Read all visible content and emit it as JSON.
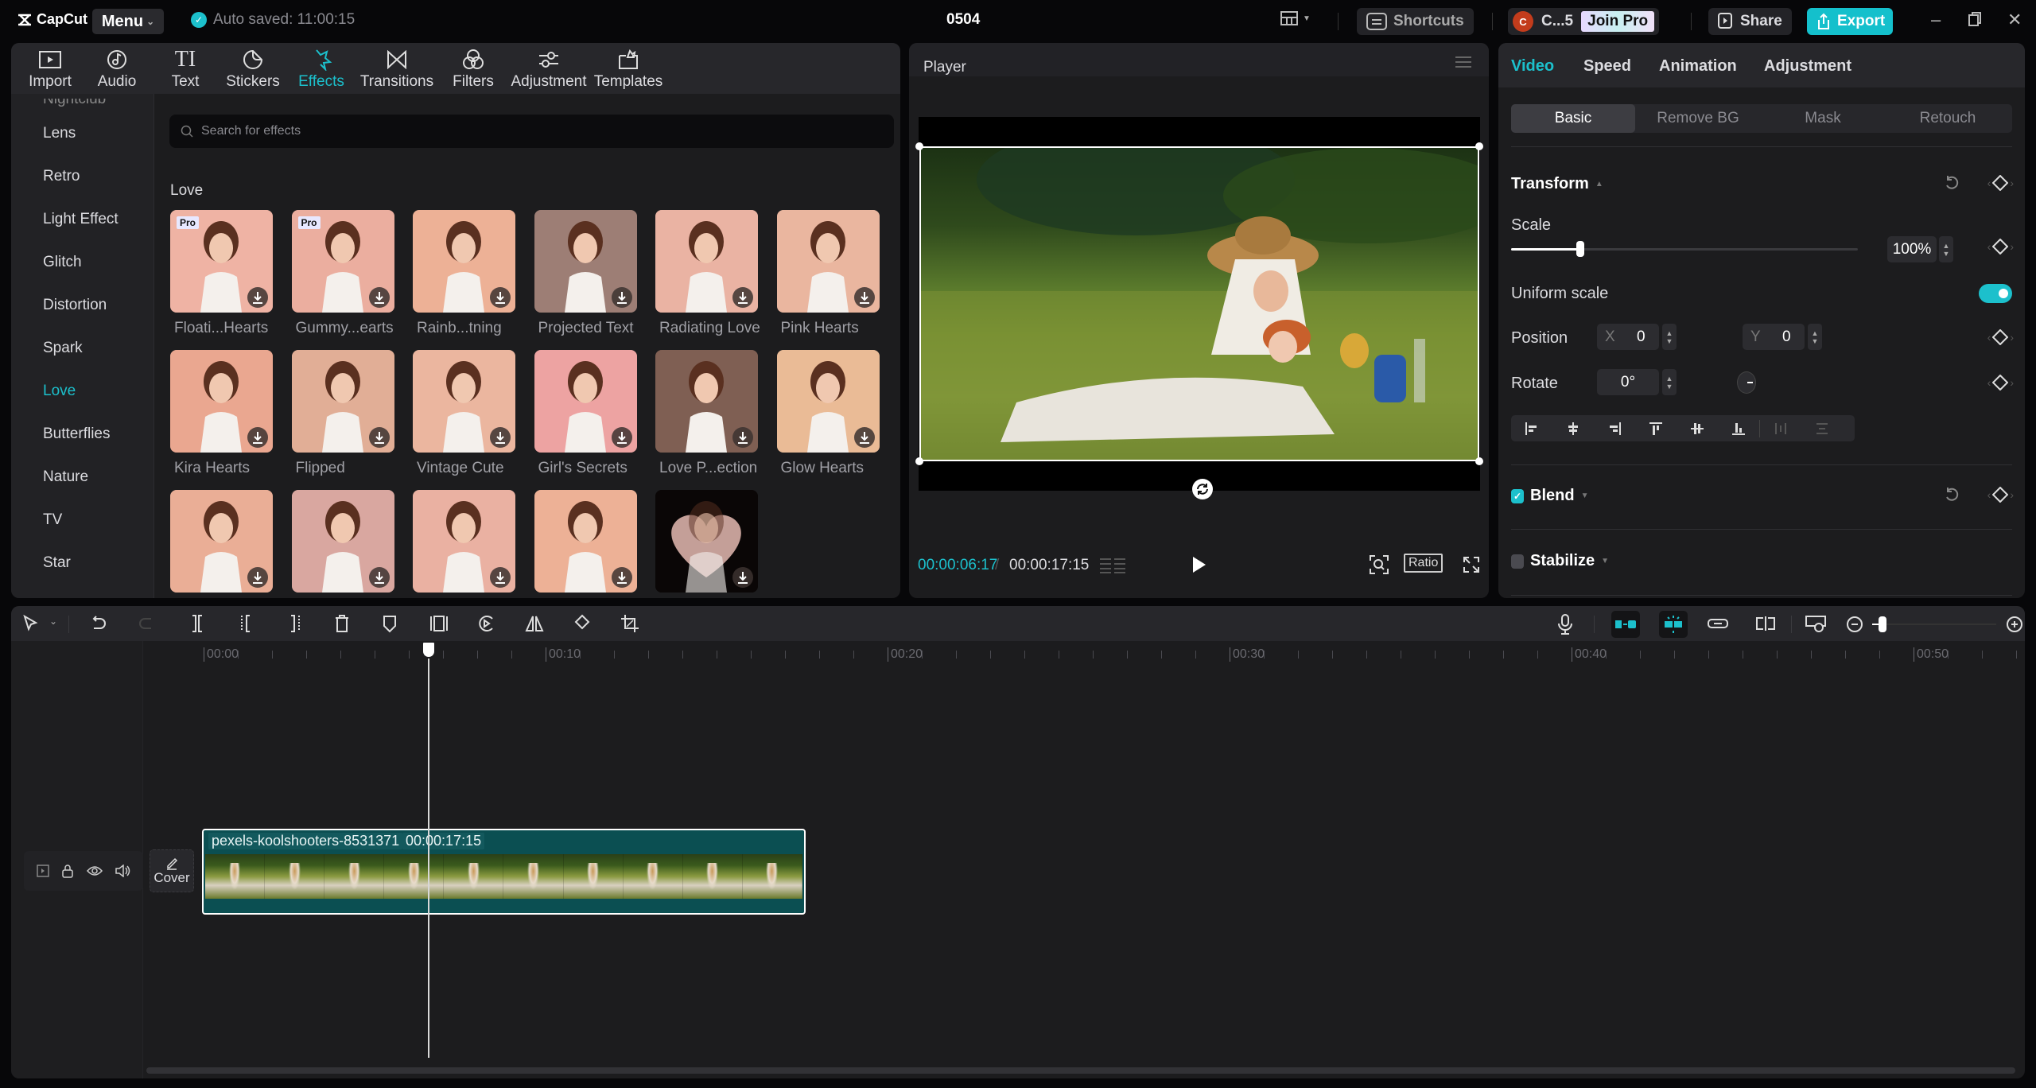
{
  "app": {
    "name": "CapCut",
    "menu_label": "Menu",
    "autosave": "Auto saved: 11:00:15",
    "project_title": "0504",
    "shortcuts_label": "Shortcuts",
    "user_initial": "C",
    "user_name": "C...5",
    "join_pro_label": "Join Pro",
    "share_label": "Share",
    "export_label": "Export",
    "accent_color": "#1cc0cc"
  },
  "toolbar": {
    "items": [
      {
        "label": "Import",
        "icon": "import-icon"
      },
      {
        "label": "Audio",
        "icon": "audio-icon"
      },
      {
        "label": "Text",
        "icon": "text-icon"
      },
      {
        "label": "Stickers",
        "icon": "sticker-icon"
      },
      {
        "label": "Effects",
        "icon": "effects-icon",
        "active": true
      },
      {
        "label": "Transitions",
        "icon": "transitions-icon"
      },
      {
        "label": "Filters",
        "icon": "filters-icon"
      },
      {
        "label": "Adjustment",
        "icon": "adjustment-icon"
      },
      {
        "label": "Templates",
        "icon": "templates-icon"
      }
    ]
  },
  "categories": {
    "partial_top": "Nightclub",
    "items": [
      "Lens",
      "Retro",
      "Light Effect",
      "Glitch",
      "Distortion",
      "Spark",
      "Love",
      "Butterflies",
      "Nature",
      "TV",
      "Star"
    ],
    "active": "Love"
  },
  "effects": {
    "search_placeholder": "Search for effects",
    "section_title": "Love",
    "items": [
      {
        "label": "Floati...Hearts",
        "pro": true
      },
      {
        "label": "Gummy...earts",
        "pro": true
      },
      {
        "label": "Rainb...tning",
        "pro": false
      },
      {
        "label": "Projected Text",
        "pro": false
      },
      {
        "label": "Radiating Love",
        "pro": false
      },
      {
        "label": "Pink Hearts",
        "pro": false
      },
      {
        "label": "Kira Hearts",
        "pro": false
      },
      {
        "label": "Flipped",
        "pro": false
      },
      {
        "label": "Vintage Cute",
        "pro": false
      },
      {
        "label": "Girl's Secrets",
        "pro": false
      },
      {
        "label": "Love P...ection",
        "pro": false
      },
      {
        "label": "Glow Hearts",
        "pro": false
      },
      {
        "label": "",
        "pro": false
      },
      {
        "label": "",
        "pro": false
      },
      {
        "label": "",
        "pro": false
      },
      {
        "label": "",
        "pro": false
      },
      {
        "label": "",
        "pro": false
      }
    ],
    "pro_badge": "Pro"
  },
  "player": {
    "title": "Player",
    "current_time": "00:00:06:17",
    "separator": "/",
    "total_time": "00:00:17:15",
    "ratio_label": "Ratio"
  },
  "inspector": {
    "tabs": [
      "Video",
      "Speed",
      "Animation",
      "Adjustment"
    ],
    "active_tab": "Video",
    "subtabs": [
      "Basic",
      "Remove BG",
      "Mask",
      "Retouch"
    ],
    "active_subtab": "Basic",
    "transform_label": "Transform",
    "scale_label": "Scale",
    "scale_value": "100%",
    "scale_slider_fraction": 0.2,
    "uniform_scale_label": "Uniform scale",
    "uniform_scale_on": true,
    "position_label": "Position",
    "position_x_label": "X",
    "position_x": "0",
    "position_y_label": "Y",
    "position_y": "0",
    "rotate_label": "Rotate",
    "rotate_value": "0°",
    "blend_label": "Blend",
    "blend_checked": true,
    "stabilize_label": "Stabilize",
    "stabilize_checked": false
  },
  "timeline": {
    "ruler": [
      "00:00",
      "00:10",
      "00:20",
      "00:30",
      "00:40",
      "00:50"
    ],
    "cover_label": "Cover",
    "clip_name": "pexels-koolshooters-8531371",
    "clip_duration": "00:00:17:15",
    "zoom_fraction": 0.05
  }
}
